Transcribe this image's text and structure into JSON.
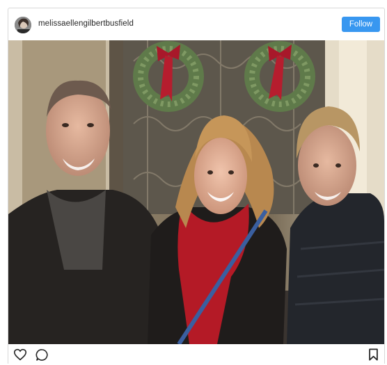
{
  "post": {
    "username": "melissaellengilbertbusfield",
    "follow_label": "Follow",
    "photo_alt": "Three people smiling in front of wreaths with red bows"
  },
  "actions": {
    "like_icon": "heart-icon",
    "comment_icon": "comment-icon",
    "save_icon": "bookmark-icon"
  },
  "colors": {
    "accent": "#3897f0",
    "text": "#262626",
    "border": "#d8d8d8"
  }
}
